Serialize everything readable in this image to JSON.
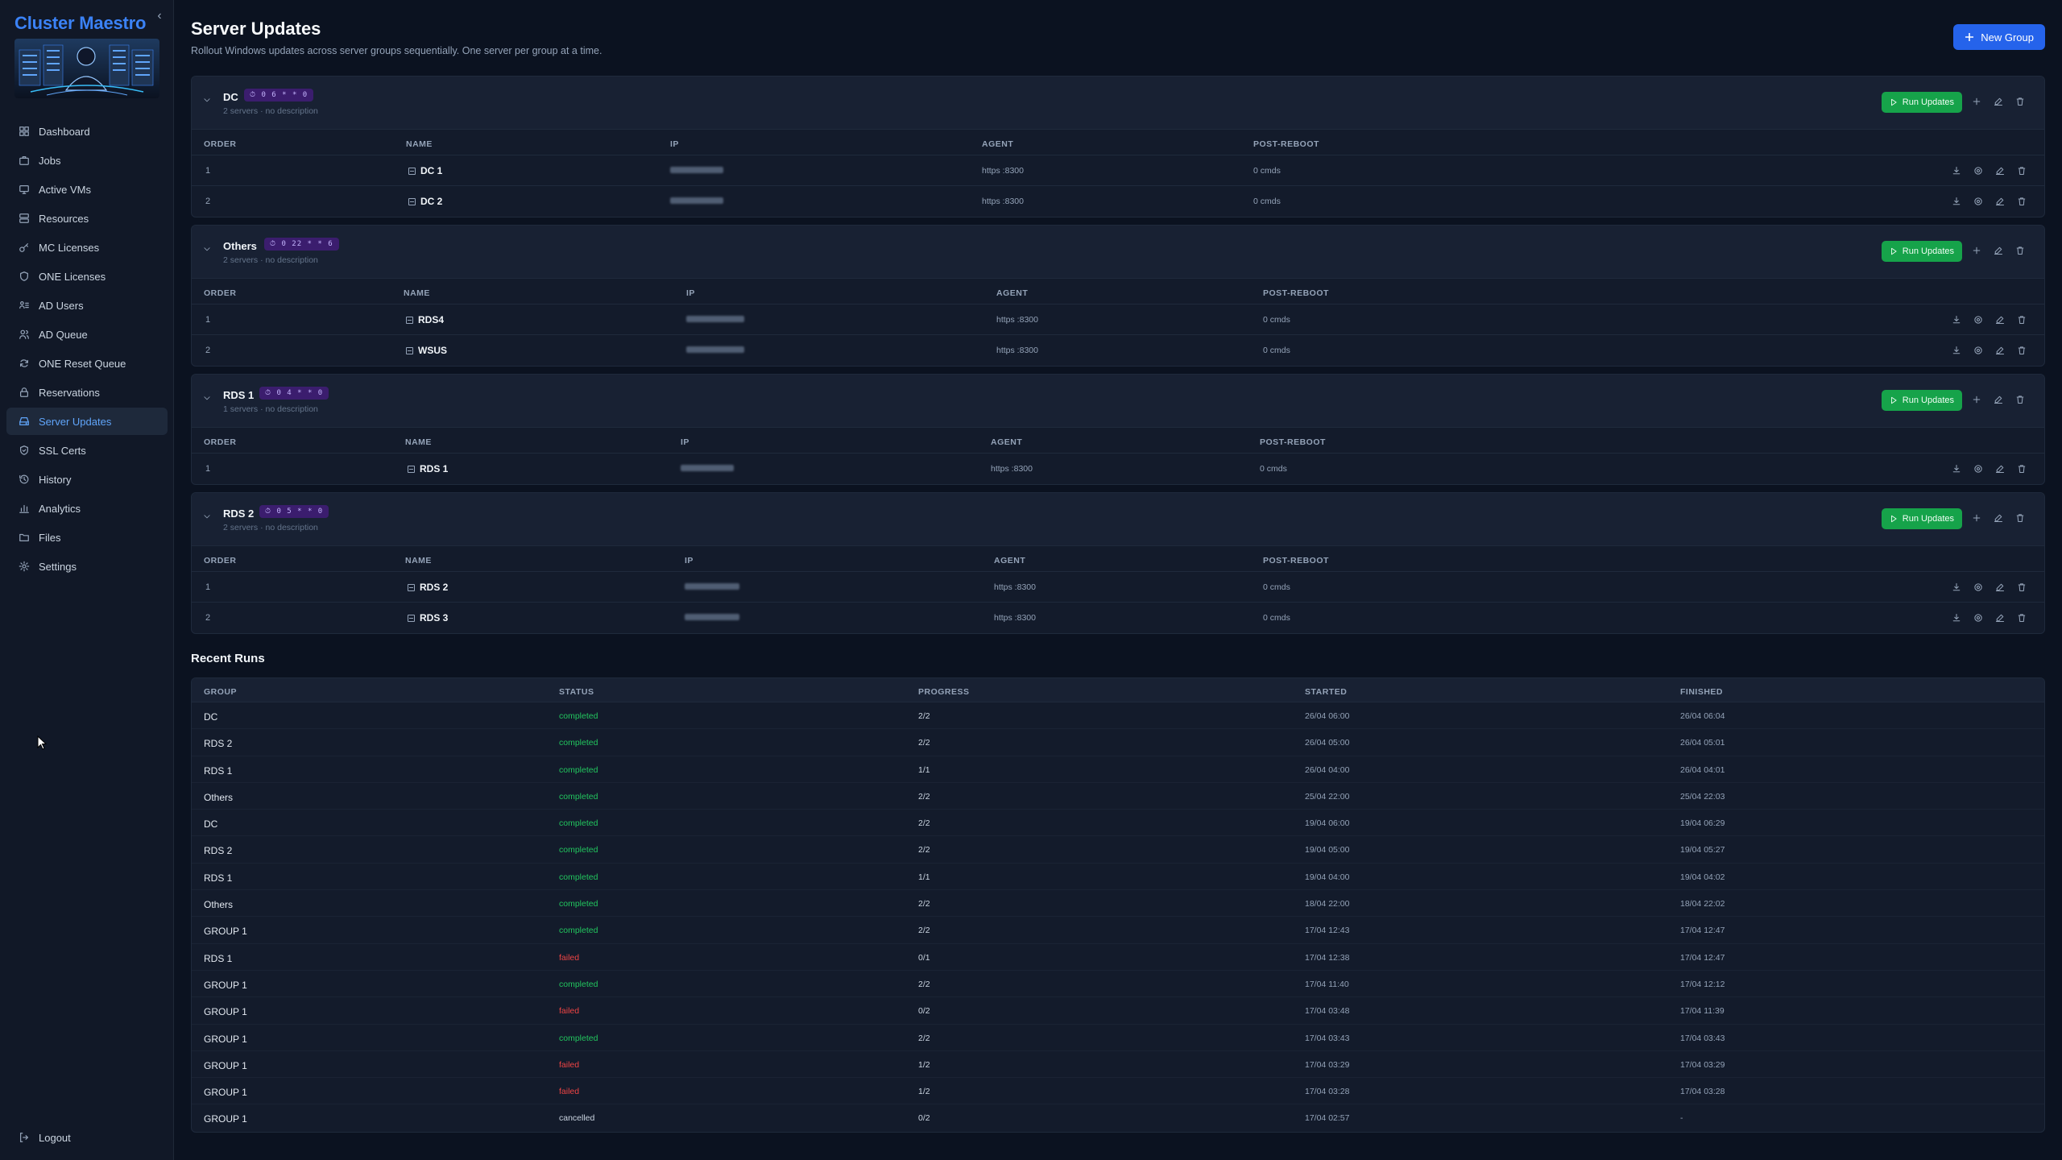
{
  "sidebar": {
    "brand": "Cluster Maestro",
    "collapse_glyph": "‹",
    "items": [
      {
        "label": "Dashboard",
        "icon": "dashboard-icon",
        "active": false
      },
      {
        "label": "Jobs",
        "icon": "briefcase-icon",
        "active": false
      },
      {
        "label": "Active VMs",
        "icon": "monitor-icon",
        "active": false
      },
      {
        "label": "Resources",
        "icon": "server-icon",
        "active": false
      },
      {
        "label": "MC Licenses",
        "icon": "key-icon",
        "active": false
      },
      {
        "label": "ONE Licenses",
        "icon": "shield-icon",
        "active": false
      },
      {
        "label": "AD Users",
        "icon": "users-list-icon",
        "active": false
      },
      {
        "label": "AD Queue",
        "icon": "users-icon",
        "active": false
      },
      {
        "label": "ONE Reset Queue",
        "icon": "refresh-icon",
        "active": false
      },
      {
        "label": "Reservations",
        "icon": "lock-icon",
        "active": false
      },
      {
        "label": "Server Updates",
        "icon": "hard-drive-icon",
        "active": true
      },
      {
        "label": "SSL Certs",
        "icon": "shield-check-icon",
        "active": false
      },
      {
        "label": "History",
        "icon": "history-icon",
        "active": false
      },
      {
        "label": "Analytics",
        "icon": "bar-chart-icon",
        "active": false
      },
      {
        "label": "Files",
        "icon": "folder-icon",
        "active": false
      },
      {
        "label": "Settings",
        "icon": "gear-icon",
        "active": false
      }
    ],
    "logout": "Logout"
  },
  "header": {
    "title": "Server Updates",
    "subtitle": "Rollout Windows updates across server groups sequentially. One server per group at a time.",
    "new_group": "New Group"
  },
  "table_headers": {
    "order": "ORDER",
    "name": "NAME",
    "ip": "IP",
    "agent": "AGENT",
    "post": "POST-REBOOT"
  },
  "run_label": "Run Updates",
  "groups": [
    {
      "name": "DC",
      "schedule": "⏱ 0 6 * * 0",
      "desc": "2 servers · no description",
      "servers": [
        {
          "order": "1",
          "name": "DC 1",
          "agent": "https :8300",
          "post": "0 cmds"
        },
        {
          "order": "2",
          "name": "DC 2",
          "agent": "https :8300",
          "post": "0 cmds"
        }
      ]
    },
    {
      "name": "Others",
      "schedule": "⏱ 0 22 * * 6",
      "desc": "2 servers · no description",
      "servers": [
        {
          "order": "1",
          "name": "RDS4",
          "agent": "https :8300",
          "post": "0 cmds"
        },
        {
          "order": "2",
          "name": "WSUS",
          "agent": "https :8300",
          "post": "0 cmds"
        }
      ]
    },
    {
      "name": "RDS 1",
      "schedule": "⏱ 0 4 * * 0",
      "desc": "1 servers · no description",
      "servers": [
        {
          "order": "1",
          "name": "RDS 1",
          "agent": "https :8300",
          "post": "0 cmds"
        }
      ]
    },
    {
      "name": "RDS 2",
      "schedule": "⏱ 0 5 * * 0",
      "desc": "2 servers · no description",
      "servers": [
        {
          "order": "1",
          "name": "RDS 2",
          "agent": "https :8300",
          "post": "0 cmds"
        },
        {
          "order": "2",
          "name": "RDS 3",
          "agent": "https :8300",
          "post": "0 cmds"
        }
      ]
    }
  ],
  "recent_runs": {
    "title": "Recent Runs",
    "headers": {
      "group": "GROUP",
      "status": "STATUS",
      "progress": "PROGRESS",
      "started": "STARTED",
      "finished": "FINISHED"
    },
    "rows": [
      {
        "group": "DC",
        "status": "completed",
        "progress": "2/2",
        "started": "26/04 06:00",
        "finished": "26/04 06:04"
      },
      {
        "group": "RDS 2",
        "status": "completed",
        "progress": "2/2",
        "started": "26/04 05:00",
        "finished": "26/04 05:01"
      },
      {
        "group": "RDS 1",
        "status": "completed",
        "progress": "1/1",
        "started": "26/04 04:00",
        "finished": "26/04 04:01"
      },
      {
        "group": "Others",
        "status": "completed",
        "progress": "2/2",
        "started": "25/04 22:00",
        "finished": "25/04 22:03"
      },
      {
        "group": "DC",
        "status": "completed",
        "progress": "2/2",
        "started": "19/04 06:00",
        "finished": "19/04 06:29"
      },
      {
        "group": "RDS 2",
        "status": "completed",
        "progress": "2/2",
        "started": "19/04 05:00",
        "finished": "19/04 05:27"
      },
      {
        "group": "RDS 1",
        "status": "completed",
        "progress": "1/1",
        "started": "19/04 04:00",
        "finished": "19/04 04:02"
      },
      {
        "group": "Others",
        "status": "completed",
        "progress": "2/2",
        "started": "18/04 22:00",
        "finished": "18/04 22:02"
      },
      {
        "group": "GROUP 1",
        "status": "completed",
        "progress": "2/2",
        "started": "17/04 12:43",
        "finished": "17/04 12:47"
      },
      {
        "group": "RDS 1",
        "status": "failed",
        "progress": "0/1",
        "started": "17/04 12:38",
        "finished": "17/04 12:47"
      },
      {
        "group": "GROUP 1",
        "status": "completed",
        "progress": "2/2",
        "started": "17/04 11:40",
        "finished": "17/04 12:12"
      },
      {
        "group": "GROUP 1",
        "status": "failed",
        "progress": "0/2",
        "started": "17/04 03:48",
        "finished": "17/04 11:39"
      },
      {
        "group": "GROUP 1",
        "status": "completed",
        "progress": "2/2",
        "started": "17/04 03:43",
        "finished": "17/04 03:43"
      },
      {
        "group": "GROUP 1",
        "status": "failed",
        "progress": "1/2",
        "started": "17/04 03:29",
        "finished": "17/04 03:29"
      },
      {
        "group": "GROUP 1",
        "status": "failed",
        "progress": "1/2",
        "started": "17/04 03:28",
        "finished": "17/04 03:28"
      },
      {
        "group": "GROUP 1",
        "status": "cancelled",
        "progress": "0/2",
        "started": "17/04 02:57",
        "finished": "-"
      }
    ]
  },
  "colors": {
    "accent": "#2563eb",
    "success": "#16a34a",
    "completed": "#22c55e",
    "failed": "#ef4444",
    "schedule_badge": "#3b1d6e"
  }
}
